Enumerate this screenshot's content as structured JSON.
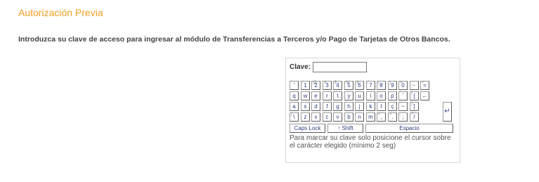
{
  "page": {
    "title": "Autorización Previa",
    "intro": "Introduzca su clave de acceso para ingresar al módulo de Transferencias a Terceros y/o Pago de Tarjetas de Otros Bancos."
  },
  "login": {
    "label": "Clave:",
    "value": ""
  },
  "keyboard": {
    "rows": [
      [
        {
          "main": "'",
          "shift": "\""
        },
        {
          "main": "1",
          "shift": "!"
        },
        {
          "main": "2",
          "shift": "@"
        },
        {
          "main": "3",
          "shift": "#"
        },
        {
          "main": "4",
          "shift": "$"
        },
        {
          "main": "5",
          "shift": "%"
        },
        {
          "main": "6",
          "shift": "&"
        },
        {
          "main": "7",
          "shift": "/"
        },
        {
          "main": "8",
          "shift": "("
        },
        {
          "main": "9",
          "shift": ")"
        },
        {
          "main": "0",
          "shift": "="
        },
        {
          "main": "-",
          "shift": "_"
        },
        {
          "main": "=",
          "shift": "+"
        }
      ],
      [
        {
          "main": "q",
          "shift": ""
        },
        {
          "main": "w",
          "shift": ""
        },
        {
          "main": "e",
          "shift": ""
        },
        {
          "main": "r",
          "shift": ""
        },
        {
          "main": "t",
          "shift": ""
        },
        {
          "main": "y",
          "shift": ""
        },
        {
          "main": "u",
          "shift": ""
        },
        {
          "main": "i",
          "shift": ""
        },
        {
          "main": "o",
          "shift": ""
        },
        {
          "main": "p",
          "shift": ""
        },
        {
          "main": "'",
          "shift": "`"
        },
        {
          "main": "[",
          "shift": "{"
        },
        {
          "main": "←",
          "shift": ""
        }
      ],
      [
        {
          "main": "a",
          "shift": ""
        },
        {
          "main": "s",
          "shift": ""
        },
        {
          "main": "d",
          "shift": ""
        },
        {
          "main": "f",
          "shift": ""
        },
        {
          "main": "g",
          "shift": ""
        },
        {
          "main": "h",
          "shift": ""
        },
        {
          "main": "j",
          "shift": ""
        },
        {
          "main": "k",
          "shift": ""
        },
        {
          "main": "l",
          "shift": ""
        },
        {
          "main": "ç",
          "shift": ""
        },
        {
          "main": "~",
          "shift": "^"
        },
        {
          "main": "]",
          "shift": "}"
        }
      ],
      [
        {
          "main": "\\",
          "shift": "|"
        },
        {
          "main": "z",
          "shift": ""
        },
        {
          "main": "x",
          "shift": ""
        },
        {
          "main": "c",
          "shift": ""
        },
        {
          "main": "v",
          "shift": ""
        },
        {
          "main": "b",
          "shift": ""
        },
        {
          "main": "n",
          "shift": ""
        },
        {
          "main": "m",
          "shift": ""
        },
        {
          "main": ",",
          "shift": "<"
        },
        {
          "main": ".",
          "shift": ">"
        },
        {
          "main": ";",
          "shift": ":"
        },
        {
          "main": "/",
          "shift": "?"
        }
      ]
    ],
    "enter": "↵",
    "caps_lock": "Caps Lock",
    "shift": "↑ Shift",
    "space": "Espacio"
  },
  "hint": "Para marcar su clave solo posicione el cursor sobre el carácter elegido (mínimo 2 seg)",
  "colors": {
    "title": "#f0a020",
    "key_text": "#2c3e80"
  }
}
